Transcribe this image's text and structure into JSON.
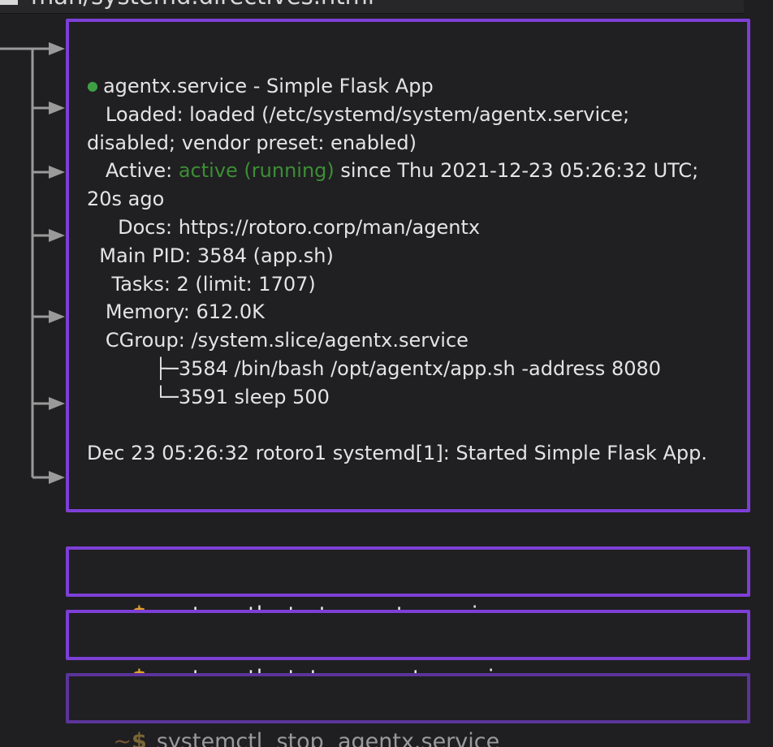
{
  "header": {
    "path": "man/systemd.directives.html"
  },
  "status_output": {
    "bullet": "●",
    "service_title": "agentx.service - Simple Flask App",
    "loaded_line": "   Loaded: loaded (/etc/systemd/system/agentx.service;",
    "loaded_cont": "disabled; vendor preset: enabled)",
    "active_label": "   Active: ",
    "active_state": "active (running)",
    "active_since": " since Thu 2021-12-23 05:26:32 UTC;",
    "active_cont": "20s ago",
    "docs_line": "     Docs: https://rotoro.corp/man/agentx",
    "pid_line": "  Main PID: 3584 (app.sh)",
    "tasks_line": "    Tasks: 2 (limit: 1707)",
    "memory_line": "   Memory: 612.0K",
    "cgroup_line": "   CGroup: /system.slice/agentx.service",
    "cgroup_child1": "           ├─3584 /bin/bash /opt/agentx/app.sh -address 8080",
    "cgroup_child2": "           └─3591 sleep 500",
    "log_line": "Dec 23 05:26:32 rotoro1 systemd[1]: Started Simple Flask App."
  },
  "commands": [
    {
      "tilde": "~",
      "dollar": "$",
      "text": "systemctl  start  agentx.service"
    },
    {
      "tilde": "~",
      "dollar": "$",
      "text": "systemctl  status  agentx.service"
    },
    {
      "tilde": "~",
      "dollar": "$",
      "text": "systemctl  stop  agentx.service"
    }
  ],
  "colors": {
    "panel_border": "#7d3fd6",
    "active_green": "#3c8f34",
    "prompt_orange": "#e0a02a",
    "background": "#1f1f21",
    "tree_connector": "#9a9a9a"
  }
}
